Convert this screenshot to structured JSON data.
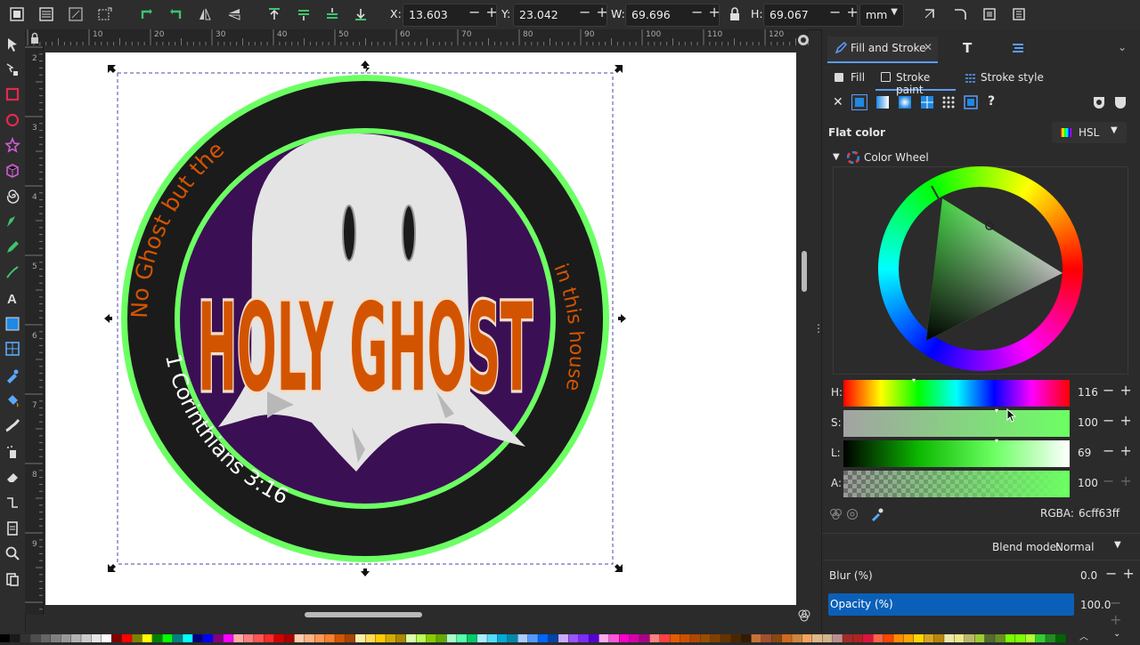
{
  "toolbar": {
    "x_label": "X:",
    "x_value": "13.603",
    "y_label": "Y:",
    "y_value": "23.042",
    "w_label": "W:",
    "w_value": "69.696",
    "h_label": "H:",
    "h_value": "69.067",
    "unit": "mm"
  },
  "canvas": {
    "top_text": "No Ghost but the",
    "right_text": "in this house",
    "bottom_text": "1 Corinthians 3:16",
    "title_text": "HOLY GHOST",
    "ruler_top_labels": [
      "10",
      "20",
      "30",
      "40",
      "50",
      "60",
      "70",
      "80",
      "90",
      "100",
      "110",
      "120"
    ],
    "ruler_left_labels": [
      "2",
      "3",
      "4",
      "5",
      "6",
      "7",
      "8",
      "9"
    ]
  },
  "panel": {
    "tabs": {
      "fill_stroke": "Fill and Stroke"
    },
    "subtabs": {
      "fill": "Fill",
      "stroke_paint": "Stroke paint",
      "stroke_style": "Stroke style"
    },
    "flat_color": "Flat color",
    "mode": "HSL",
    "color_wheel": "Color Wheel",
    "sliders": [
      {
        "label": "H:",
        "value": "116"
      },
      {
        "label": "S:",
        "value": "100"
      },
      {
        "label": "L:",
        "value": "69"
      },
      {
        "label": "A:",
        "value": "100"
      }
    ],
    "rgba_label": "RGBA:",
    "rgba_value": "6cff63ff",
    "blend_label": "Blend mode:",
    "blend_value": "Normal",
    "blur_label": "Blur (%)",
    "blur_value": "0.0",
    "opacity_label": "Opacity (%)",
    "opacity_value": "100.0",
    "opacity_fraction": 1.0
  },
  "colors": {
    "stroke_green": "#6cff63",
    "accent_blue": "#0a60b8",
    "orange": "#d35400",
    "purple": "#3b0f54"
  }
}
